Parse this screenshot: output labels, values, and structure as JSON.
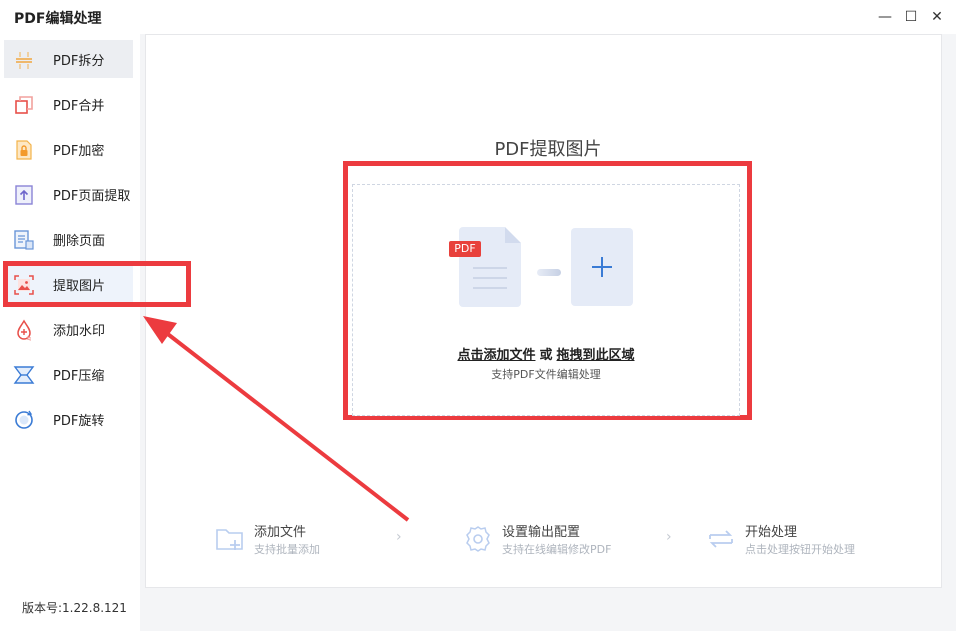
{
  "window": {
    "title": "PDF编辑处理",
    "minimize": "—",
    "maximize": "☐",
    "close": "✕"
  },
  "sidebar": {
    "items": [
      {
        "label": "PDF拆分",
        "icon": "split-icon"
      },
      {
        "label": "PDF合并",
        "icon": "merge-icon"
      },
      {
        "label": "PDF加密",
        "icon": "lock-icon"
      },
      {
        "label": "PDF页面提取",
        "icon": "page-extract-icon"
      },
      {
        "label": "删除页面",
        "icon": "delete-page-icon"
      },
      {
        "label": "提取图片",
        "icon": "image-icon"
      },
      {
        "label": "添加水印",
        "icon": "watermark-icon"
      },
      {
        "label": "PDF压缩",
        "icon": "compress-icon"
      },
      {
        "label": "PDF旋转",
        "icon": "rotate-icon"
      }
    ],
    "version": "版本号:1.22.8.121"
  },
  "main": {
    "title": "PDF提取图片",
    "drop": {
      "badge": "PDF",
      "add_link": "点击添加文件",
      "or": "或",
      "drag_link": "拖拽到此区域",
      "sub": "支持PDF文件编辑处理"
    },
    "steps": [
      {
        "title": "添加文件",
        "sub": "支持批量添加",
        "icon": "folder-add-icon"
      },
      {
        "title": "设置输出配置",
        "sub": "支持在线编辑修改PDF",
        "icon": "settings-icon"
      },
      {
        "title": "开始处理",
        "sub": "点击处理按钮开始处理",
        "icon": "process-icon"
      }
    ],
    "chevron": "›"
  },
  "colors": {
    "accent_red": "#ec3b3f",
    "accent_blue": "#3a7bd5"
  }
}
